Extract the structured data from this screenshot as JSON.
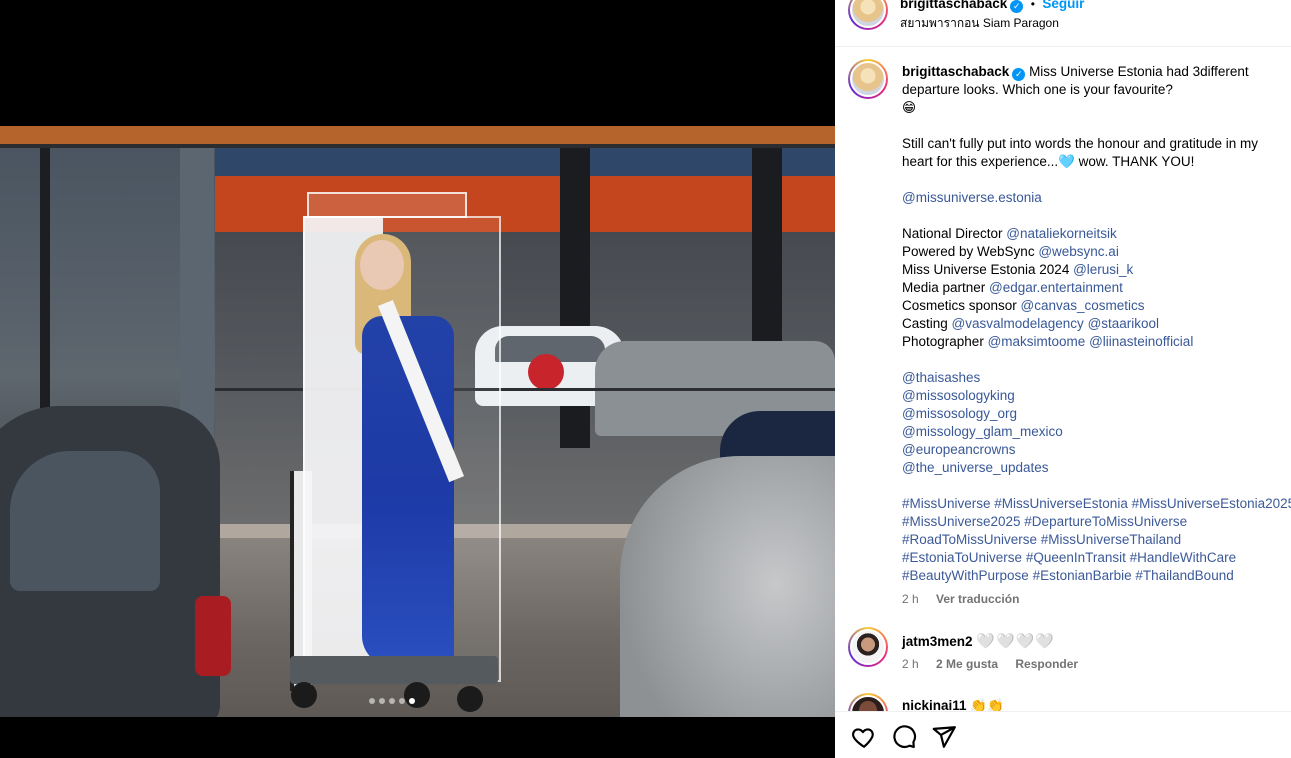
{
  "post": {
    "username": "brigittaschaback",
    "separator": "•",
    "follow_label": "Seguir",
    "location": "สยามพารากอน Siam Paragon",
    "carousel_count": 5,
    "carousel_active": 5
  },
  "caption": {
    "username": "brigittaschaback",
    "line1": "Miss Universe Estonia had 3different",
    "line2": "departure looks. Which one is your favourite?",
    "emoji": "😁",
    "line4": "Still can't fully put into words the honour and gratitude in my",
    "line5": "heart for this experience...🩵 wow. THANK YOU!",
    "mention_main": "@missuniverse.estonia",
    "credits": [
      {
        "label": "National Director ",
        "mentions": [
          "@nataliekorneitsik"
        ]
      },
      {
        "label": "Powered by WebSync ",
        "mentions": [
          "@websync.ai"
        ]
      },
      {
        "label": "Miss Universe Estonia 2024 ",
        "mentions": [
          "@lerusi_k"
        ]
      },
      {
        "label": "Media partner ",
        "mentions": [
          "@edgar.entertainment"
        ]
      },
      {
        "label": "Cosmetics sponsor ",
        "mentions": [
          "@canvas_cosmetics"
        ]
      },
      {
        "label": "Casting ",
        "mentions": [
          "@vasvalmodelagency",
          "@staarikool"
        ]
      },
      {
        "label": "Photographer ",
        "mentions": [
          "@maksimtoome",
          "@liinasteinofficial"
        ]
      }
    ],
    "mention_list": [
      "@thaisashes",
      "@missosologyking",
      "@missosology_org",
      "@missology_glam_mexico",
      "@europeancrowns",
      "@the_universe_updates"
    ],
    "hashtag_lines": [
      "#MissUniverse #MissUniverseEstonia #MissUniverseEstonia2025",
      "#MissUniverse2025 #DepartureToMissUniverse",
      "#RoadToMissUniverse #MissUniverseThailand",
      "#EstoniaToUniverse #QueenInTransit #HandleWithCare",
      "#BeautyWithPurpose #EstonianBarbie #ThailandBound"
    ],
    "time": "2 h",
    "translate": "Ver traducción"
  },
  "comments": [
    {
      "username": "jatm3men2",
      "text": "🤍🤍🤍🤍",
      "time": "2 h",
      "likes": "2 Me gusta",
      "reply": "Responder"
    },
    {
      "username": "nickinai11",
      "text": "👏👏"
    }
  ],
  "actions": {
    "like_icon": "heart-icon",
    "comment_icon": "comment-icon",
    "share_icon": "paper-plane-icon"
  },
  "colors": {
    "link": "#385898",
    "follow": "#0095f6",
    "muted": "#737373"
  }
}
